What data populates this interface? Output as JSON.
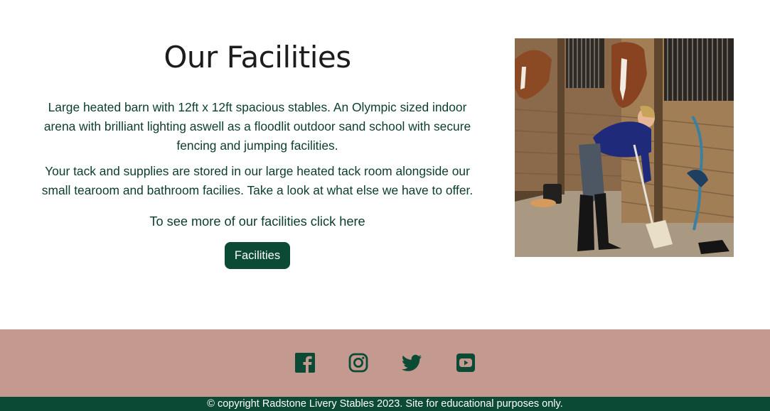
{
  "facilities": {
    "title": "Our Facilities",
    "paragraph_1": "Large heated barn with 12ft x 12ft spacious stables. An Olympic sized indoor arena with brilliant lighting aswell as a floodlit outdoor sand school with secure fencing and jumping facilities.",
    "paragraph_2": "Your tack and supplies are stored in our large heated tack room alongside our small tearoom and bathroom facilies. Take a look at what else we have to offer.",
    "cta_text": "To see more of our facilities click here",
    "button_label": "Facilities",
    "image_alt": "Woman sweeping the stable aisle beside horses in their stalls"
  },
  "footer": {
    "social_icons": [
      "facebook-icon",
      "instagram-icon",
      "twitter-icon",
      "youtube-icon"
    ],
    "copyright": "© copyright Radstone Livery Stables 2023. Site for educational purposes only."
  },
  "colors": {
    "brand_green": "#0b4a35",
    "footer_pink": "#c49a90",
    "text_green": "#0b3d2c"
  }
}
